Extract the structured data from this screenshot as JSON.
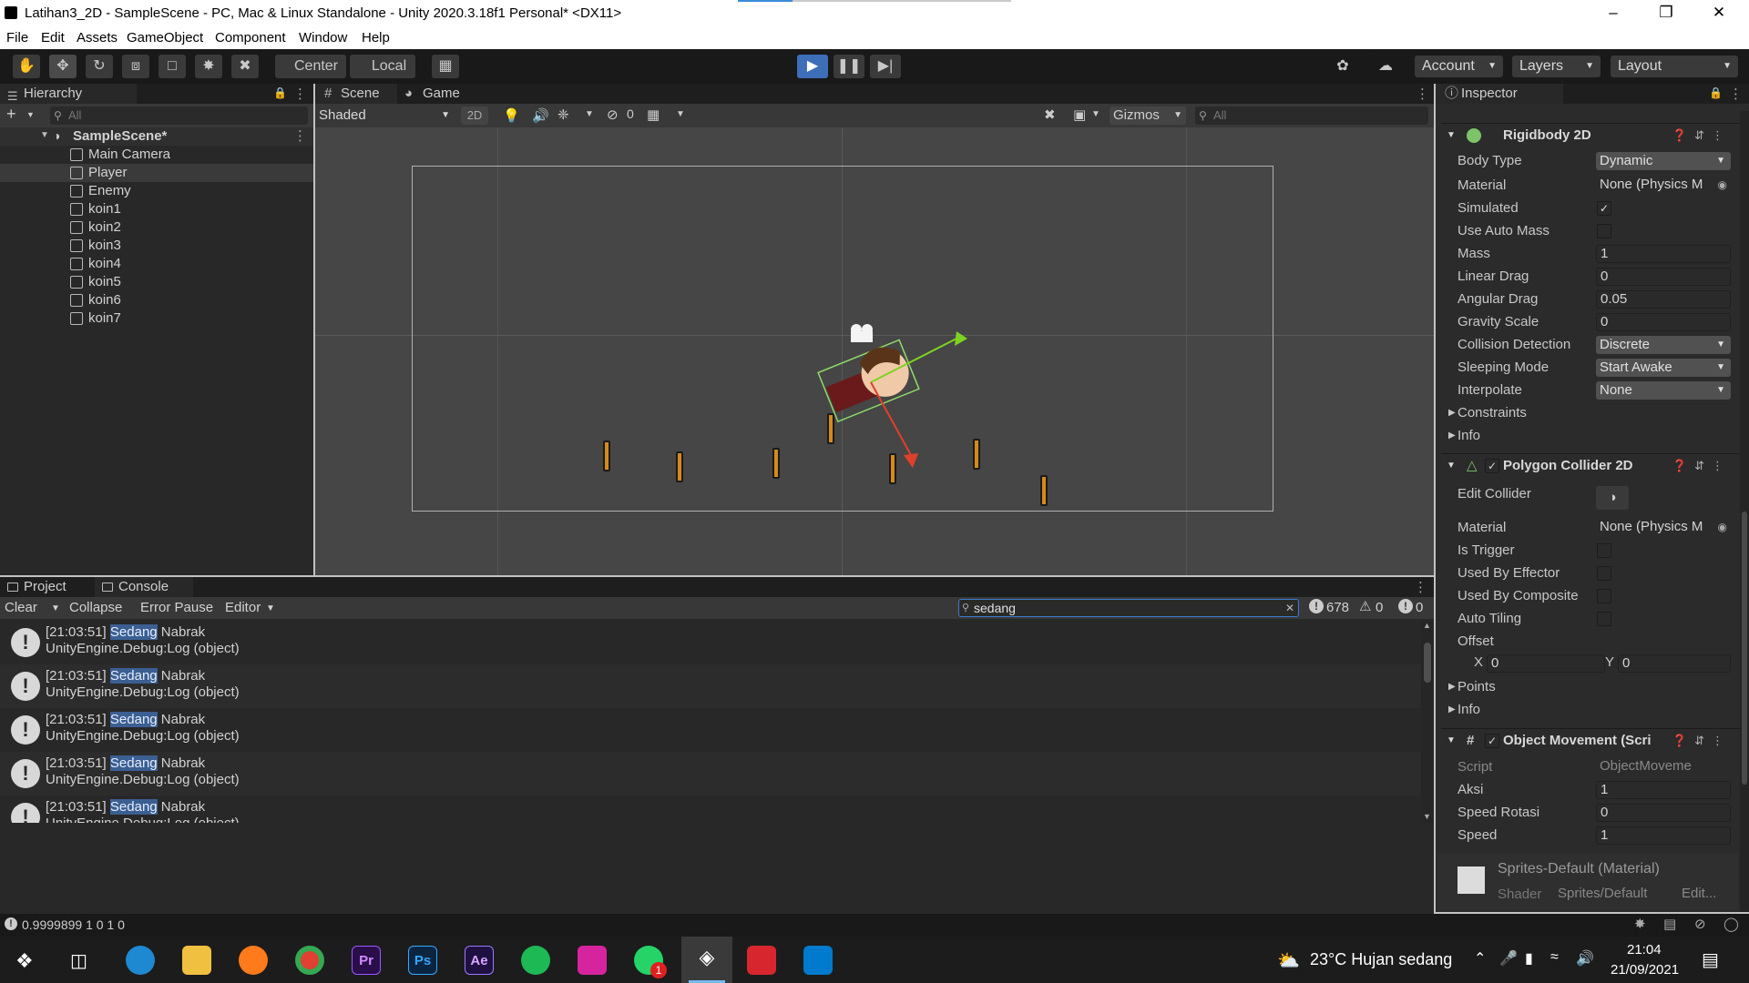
{
  "window": {
    "title": "Latihan3_2D - SampleScene - PC, Mac & Linux Standalone - Unity 2020.3.18f1 Personal* <DX11>",
    "load_progress": 0.2
  },
  "menu": [
    "File",
    "Edit",
    "Assets",
    "GameObject",
    "Component",
    "Window",
    "Help"
  ],
  "toolbar": {
    "pivot": "Center",
    "space": "Local",
    "account": "Account",
    "layers": "Layers",
    "layout": "Layout"
  },
  "hierarchy": {
    "tab": "Hierarchy",
    "search_placeholder": "All",
    "scene": "SampleScene*",
    "items": [
      "Main Camera",
      "Player",
      "Enemy",
      "koin1",
      "koin2",
      "koin3",
      "koin4",
      "koin5",
      "koin6",
      "koin7"
    ],
    "selected": "Player"
  },
  "scene_view": {
    "tabs": [
      "Scene",
      "Game"
    ],
    "shading": "Shaded",
    "mode_2d": "2D",
    "hidden_count": "0",
    "gizmos": "Gizmos",
    "search_placeholder": "All"
  },
  "bottom": {
    "tabs": [
      "Project",
      "Console"
    ],
    "clear": "Clear",
    "collapse": "Collapse",
    "error_pause": "Error Pause",
    "editor": "Editor",
    "search_value": "sedang",
    "log_count": "678",
    "warn_count": "0",
    "error_count": "0",
    "logs": [
      {
        "time": "[21:03:51]",
        "match": "Sedang",
        "rest": "Nabrak",
        "trace": "UnityEngine.Debug:Log (object)"
      },
      {
        "time": "[21:03:51]",
        "match": "Sedang",
        "rest": "Nabrak",
        "trace": "UnityEngine.Debug:Log (object)"
      },
      {
        "time": "[21:03:51]",
        "match": "Sedang",
        "rest": "Nabrak",
        "trace": "UnityEngine.Debug:Log (object)"
      },
      {
        "time": "[21:03:51]",
        "match": "Sedang",
        "rest": "Nabrak",
        "trace": "UnityEngine.Debug:Log (object)"
      },
      {
        "time": "[21:03:51]",
        "match": "Sedang",
        "rest": "Nabrak",
        "trace": "UnityEngine.Debug:Log (object)"
      }
    ],
    "status": "0.9999899 1 0 1 0"
  },
  "inspector": {
    "tab": "Inspector",
    "rigidbody": {
      "title": "Rigidbody 2D",
      "body_type_label": "Body Type",
      "body_type": "Dynamic",
      "material_label": "Material",
      "material": "None (Physics M",
      "simulated_label": "Simulated",
      "auto_mass_label": "Use Auto Mass",
      "mass_label": "Mass",
      "mass": "1",
      "linear_drag_label": "Linear Drag",
      "linear_drag": "0",
      "angular_drag_label": "Angular Drag",
      "angular_drag": "0.05",
      "gravity_label": "Gravity Scale",
      "gravity": "0",
      "collision_label": "Collision Detection",
      "collision": "Discrete",
      "sleeping_label": "Sleeping Mode",
      "sleeping": "Start Awake",
      "interpolate_label": "Interpolate",
      "interpolate": "None",
      "constraints": "Constraints",
      "info": "Info"
    },
    "collider": {
      "title": "Polygon Collider 2D",
      "edit_label": "Edit Collider",
      "material_label": "Material",
      "material": "None (Physics M",
      "trigger_label": "Is Trigger",
      "effector_label": "Used By Effector",
      "composite_label": "Used By Composite",
      "tiling_label": "Auto Tiling",
      "offset_label": "Offset",
      "x_label": "X",
      "x": "0",
      "y_label": "Y",
      "y": "0",
      "points": "Points",
      "info": "Info"
    },
    "script": {
      "title": "Object Movement (Scri",
      "script_label": "Script",
      "script": "ObjectMoveme",
      "aksi_label": "Aksi",
      "aksi": "1",
      "rot_label": "Speed Rotasi",
      "rot": "0",
      "speed_label": "Speed",
      "speed": "1"
    },
    "material": {
      "title": "Sprites-Default (Material)",
      "shader_label": "Shader",
      "shader": "Sprites/Default",
      "edit": "Edit..."
    }
  },
  "taskbar": {
    "apps": [
      "Pr",
      "Ps",
      "Ae"
    ],
    "weather": "23°C  Hujan sedang",
    "time": "21:04",
    "date": "21/09/2021",
    "whatsapp_badge": "1"
  }
}
